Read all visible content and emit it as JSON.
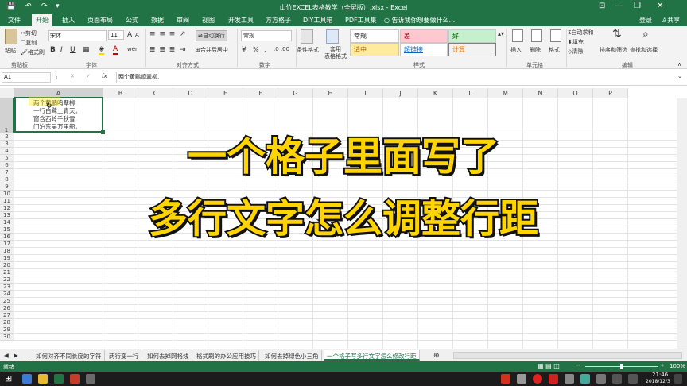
{
  "window": {
    "title": "山竹EXCEL表格教学（全屏版）.xlsx - Excel",
    "min": "—",
    "restore": "❐",
    "close": "✕",
    "ribbon_opt": "⊡"
  },
  "quick_access": {
    "save": "💾",
    "undo": "↶",
    "redo": "↷",
    "customize": "▾"
  },
  "tabs": [
    "文件",
    "开始",
    "插入",
    "页面布局",
    "公式",
    "数据",
    "审阅",
    "视图",
    "开发工具",
    "方方格子",
    "DIY工具箱",
    "PDF工具集"
  ],
  "active_tab": "开始",
  "tell_me": "告诉我你想要做什么...",
  "login": "登录",
  "share": "共享",
  "ribbon": {
    "clipboard": {
      "paste": "粘贴",
      "cut": "剪切",
      "copy": "复制",
      "painter": "格式刷",
      "group": "剪贴板"
    },
    "font": {
      "name": "宋体",
      "size": "11",
      "grow": "A",
      "shrink": "A",
      "bold": "B",
      "italic": "I",
      "underline": "U",
      "group": "字体",
      "wen": "wén",
      "fill_label": "A"
    },
    "align": {
      "wrap": "自动换行",
      "merge": "合并后居中",
      "group": "对齐方式"
    },
    "number": {
      "format": "常规",
      "group": "数字",
      "pct": "%",
      "comma": ","
    },
    "styles": {
      "cond": "条件格式",
      "table": "套用\n表格格式",
      "normal": "常规",
      "bad": "差",
      "good": "好",
      "neutral": "适中",
      "link": "超链接",
      "calc": "计算",
      "group": "样式"
    },
    "cells": {
      "insert": "插入",
      "delete": "删除",
      "format": "格式",
      "group": "单元格"
    },
    "editing": {
      "autosum": "自动求和",
      "fill": "填充",
      "clear": "清除",
      "sort": "排序和筛选",
      "find": "查找和选择",
      "group": "编辑"
    }
  },
  "formula_bar": {
    "namebox": "A1",
    "cancel": "✕",
    "enter": "✓",
    "fx": "fx",
    "content": "两个黄鹂鸣翠柳,"
  },
  "columns": [
    "A",
    "B",
    "C",
    "D",
    "E",
    "F",
    "G",
    "H",
    "I",
    "J",
    "K",
    "L",
    "M",
    "N",
    "O",
    "P"
  ],
  "rows": [
    "1",
    "2",
    "3",
    "4",
    "5",
    "6",
    "7",
    "8",
    "9",
    "10",
    "11",
    "12",
    "13",
    "14",
    "15",
    "16",
    "17",
    "18",
    "19",
    "20",
    "21",
    "22",
    "23",
    "24",
    "25",
    "26",
    "27",
    "28",
    "29",
    "30"
  ],
  "cell_a1": [
    "两个黄鹂鸣翠柳,",
    "一行白鹭上青天。",
    "窗含西岭千秋雪,",
    "门泊东吴万里船。"
  ],
  "overlay": {
    "line1": "一个格子里面写了",
    "line2": "多行文字怎么调整行距"
  },
  "sheet_nav": {
    "prev": "◀",
    "next": "▶",
    "more": "...",
    "add": "⊕"
  },
  "sheets": [
    "如何对齐不同长度的字符",
    "两行变一行",
    "如何去掉网格线",
    "格式刷的办公应用技巧",
    "如何去掉绿色小三角",
    "一个格子写多行文字怎么修改行距"
  ],
  "active_sheet": "一个格子写多行文字怎么修改行距",
  "status": {
    "mode": "就绪",
    "zoom": "100%",
    "minus": "−",
    "plus": "+"
  },
  "taskbar": {
    "time": "21:46",
    "date": "2018/12/3",
    "start": "⊞"
  }
}
